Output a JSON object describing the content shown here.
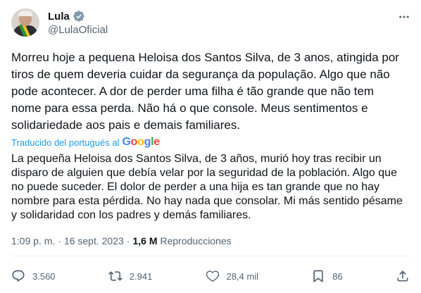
{
  "author": {
    "name": "Lula",
    "handle": "@LulaOficial"
  },
  "post": {
    "text": "Morreu hoje a pequena Heloisa dos Santos Silva, de 3 anos, atingida por tiros de quem deveria cuidar da segurança da população. Algo que não pode acontecer. A dor de perder uma filha é tão grande que não tem nome para essa perda. Não há o que console. Meus sentimentos e solidariedade aos pais e demais familiares.",
    "translated_label": "Traducido del portugués al",
    "translator_logo": "Google",
    "translation": "La pequeña Heloisa dos Santos Silva, de 3 años, murió hoy tras recibir un disparo de alguien que debía velar por la seguridad de la población. Algo que no puede suceder. El dolor de perder a una hija es tan grande que no hay nombre para esta pérdida. No hay nada que consolar. Mi más sentido pésame y solidaridad con los padres y demás familiares."
  },
  "meta": {
    "time": "1:09 p. m.",
    "separator": "·",
    "date": "16 sept. 2023",
    "views_count": "1,6 M",
    "views_label": "Reproducciones"
  },
  "actions": {
    "replies": "3.560",
    "reposts": "2.941",
    "likes": "28,4 mil",
    "bookmarks": "86"
  },
  "colors": {
    "link": "#1d9bf0",
    "secondary_text": "#536471",
    "primary_text": "#0f1419",
    "verified": "#829aab"
  },
  "icons": [
    "verified-badge-icon",
    "more-icon",
    "reply-icon",
    "repost-icon",
    "like-icon",
    "bookmark-icon",
    "share-icon"
  ]
}
